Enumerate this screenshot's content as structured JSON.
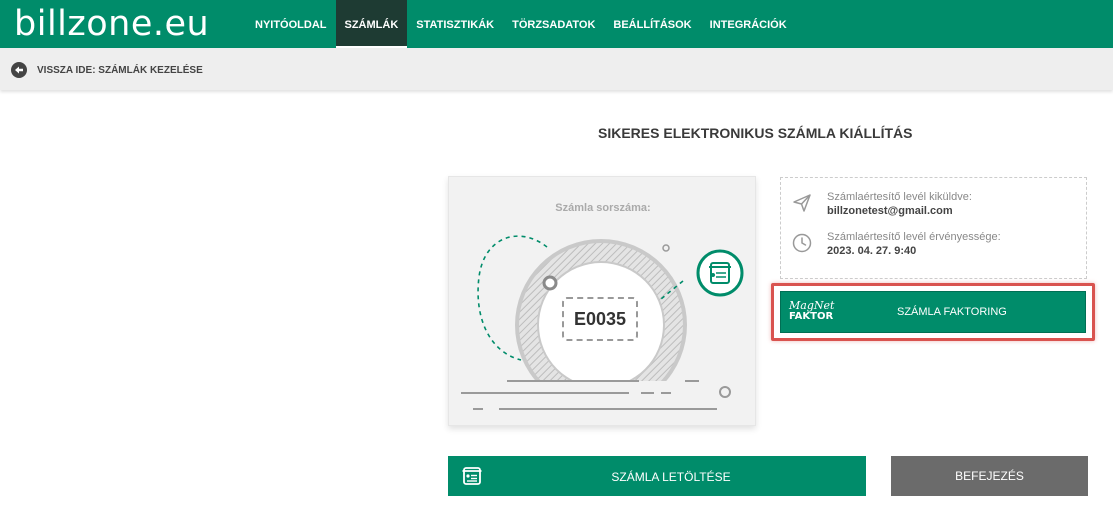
{
  "header": {
    "logo": "billzone.eu",
    "nav": [
      {
        "label": "NYITÓOLDAL",
        "active": false
      },
      {
        "label": "SZÁMLÁK",
        "active": true
      },
      {
        "label": "STATISZTIKÁK",
        "active": false
      },
      {
        "label": "TÖRZSADATOK",
        "active": false
      },
      {
        "label": "BEÁLLÍTÁSOK",
        "active": false
      },
      {
        "label": "INTEGRÁCIÓK",
        "active": false
      }
    ]
  },
  "subbar": {
    "back_label": "VISSZA IDE: SZÁMLÁK KEZELÉSE",
    "back_icon": "arrow-left-circle-icon"
  },
  "main": {
    "title": "SIKERES ELEKTRONIKUS SZÁMLA KIÁLLÍTÁS",
    "invoice": {
      "label": "Számla sorszáma:",
      "number": "E0035"
    },
    "info": {
      "sent_label": "Számlaértesítő levél kiküldve:",
      "sent_value": "billzonetest@gmail.com",
      "sent_icon": "paper-plane-icon",
      "valid_label": "Számlaértesítő levél érvényessége:",
      "valid_value": "2023. 04. 27. 9:40",
      "valid_icon": "clock-icon"
    },
    "factoring": {
      "logo_line1": "MagNet",
      "logo_line2": "FAKTOR",
      "label": "SZÁMLA FAKTORING"
    },
    "download_label": "SZÁMLA LETÖLTÉSE",
    "finish_label": "BEFEJEZÉS"
  },
  "colors": {
    "brand_green": "#008c6a",
    "nav_active": "#1e3b33",
    "highlight_red": "#d9534f",
    "finish_gray": "#6b6b6b"
  }
}
